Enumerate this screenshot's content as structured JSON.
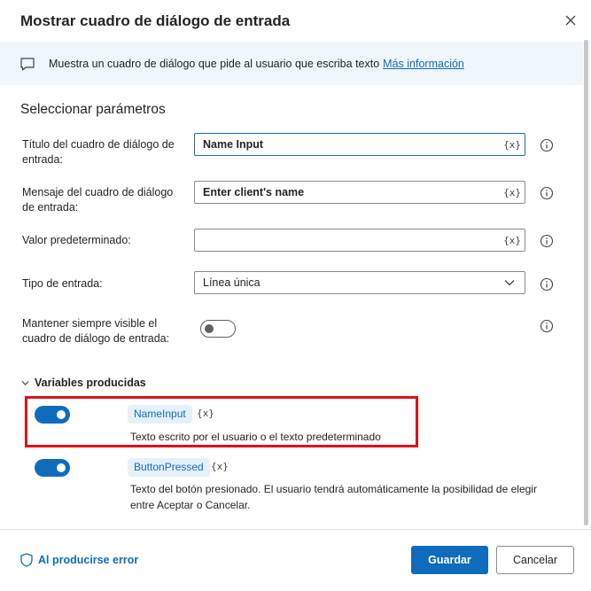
{
  "dialog": {
    "title": "Mostrar cuadro de diálogo de entrada",
    "close_icon": "close-icon"
  },
  "banner": {
    "text": "Muestra un cuadro de diálogo que pide al usuario que escriba texto",
    "link": "Más información",
    "icon": "chat-icon"
  },
  "params": {
    "section_title": "Seleccionar parámetros",
    "title_field": {
      "label": "Título del cuadro de diálogo de entrada:",
      "value": "Name Input",
      "var_btn": "{x}"
    },
    "message_field": {
      "label": "Mensaje del cuadro de diálogo de entrada:",
      "value": "Enter client's name",
      "var_btn": "{x}"
    },
    "default_field": {
      "label": "Valor predeterminado:",
      "value": "",
      "var_btn": "{x}"
    },
    "input_type": {
      "label": "Tipo de entrada:",
      "value": "Línea única"
    },
    "keep_visible": {
      "label": "Mantener siempre visible el cuadro de diálogo de entrada:",
      "enabled": false
    }
  },
  "variables": {
    "header": "Variables producidas",
    "items": [
      {
        "name": "NameInput",
        "mark": "{x}",
        "description": "Texto escrito por el usuario o el texto predeterminado",
        "enabled": true
      },
      {
        "name": "ButtonPressed",
        "mark": "{x}",
        "description": "Texto del botón presionado. El usuario tendrá automáticamente la posibilidad de elegir entre Aceptar o Cancelar.",
        "enabled": true
      }
    ]
  },
  "footer": {
    "error_link": "Al producirse error",
    "save": "Guardar",
    "cancel": "Cancelar"
  },
  "colors": {
    "accent": "#0f6cbd",
    "banner_bg": "#eff6fc",
    "highlight": "#e0101b"
  }
}
